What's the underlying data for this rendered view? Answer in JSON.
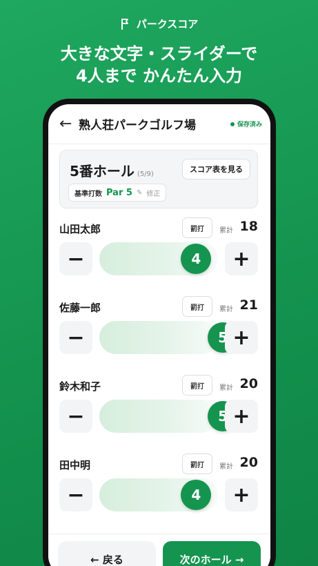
{
  "brand": {
    "name": "パークスコア",
    "icon": "flag-icon"
  },
  "headline": {
    "line1": "大きな文字・スライダーで",
    "line2": "4人まで かんたん入力"
  },
  "header": {
    "back_icon": "←",
    "course": "熟人荘パークゴルフ場",
    "saved": "保存済み"
  },
  "hole": {
    "title": "5番ホール",
    "progress": "(5/9)",
    "scorecard_button": "スコア表を見る",
    "par_label": "基準打数",
    "par_value": "Par 5",
    "edit_label": "修正"
  },
  "score_range": [
    1,
    9
  ],
  "players": [
    {
      "name": "山田太郎",
      "penalty_label": "罰打",
      "total_label": "累計",
      "total": "18",
      "stroke": 4,
      "stroke_text": "4"
    },
    {
      "name": "佐藤一郎",
      "penalty_label": "罰打",
      "total_label": "累計",
      "total": "21",
      "stroke": 5,
      "stroke_text": "5"
    },
    {
      "name": "鈴木和子",
      "penalty_label": "罰打",
      "total_label": "累計",
      "total": "20",
      "stroke": 5,
      "stroke_text": "5"
    },
    {
      "name": "田中明",
      "penalty_label": "罰打",
      "total_label": "累計",
      "total": "20",
      "stroke": 4,
      "stroke_text": "4"
    }
  ],
  "controls": {
    "minus": "−",
    "plus": "+"
  },
  "nav": {
    "prev": "← 戻る",
    "next": "次のホール →"
  },
  "colors": {
    "accent": "#15944f",
    "background": "#1fa85f"
  }
}
